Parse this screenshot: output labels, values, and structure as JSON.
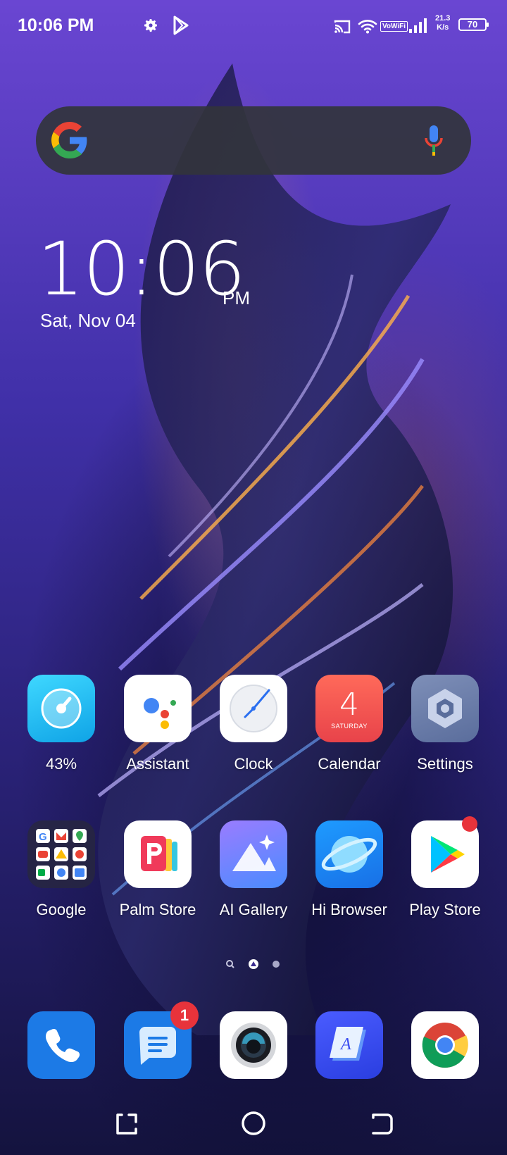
{
  "status_bar": {
    "time": "10:06 PM",
    "network_label": "VoWiFi",
    "speed_value": "21.3",
    "speed_unit": "K/s",
    "battery": "70"
  },
  "search_bar": {
    "google_icon": "google-g-icon",
    "mic_icon": "mic-icon"
  },
  "clock_widget": {
    "time": "10:06",
    "ampm": "PM",
    "date": "Sat, Nov 04"
  },
  "apps_row1": [
    {
      "label": "43%",
      "icon": "phone-master-icon"
    },
    {
      "label": "Assistant",
      "icon": "assistant-icon"
    },
    {
      "label": "Clock",
      "icon": "clock-icon"
    },
    {
      "label": "Calendar",
      "icon": "calendar-icon",
      "day": "4",
      "weekday": "SATURDAY"
    },
    {
      "label": "Settings",
      "icon": "settings-icon"
    }
  ],
  "apps_row2": [
    {
      "label": "Google",
      "icon": "google-folder-icon"
    },
    {
      "label": "Palm Store",
      "icon": "palm-store-icon"
    },
    {
      "label": "AI Gallery",
      "icon": "gallery-icon"
    },
    {
      "label": "Hi Browser",
      "icon": "browser-icon"
    },
    {
      "label": "Play Store",
      "icon": "play-store-icon"
    }
  ],
  "dock": [
    {
      "name": "Phone",
      "icon": "phone-icon"
    },
    {
      "name": "Messages",
      "icon": "messages-icon",
      "badge": "1"
    },
    {
      "name": "Camera",
      "icon": "camera-icon"
    },
    {
      "name": "Notes",
      "icon": "notes-icon"
    },
    {
      "name": "Chrome",
      "icon": "chrome-icon"
    }
  ],
  "colors": {
    "accent_red": "#e8333b",
    "dock_blue": "#1c7ae6"
  }
}
